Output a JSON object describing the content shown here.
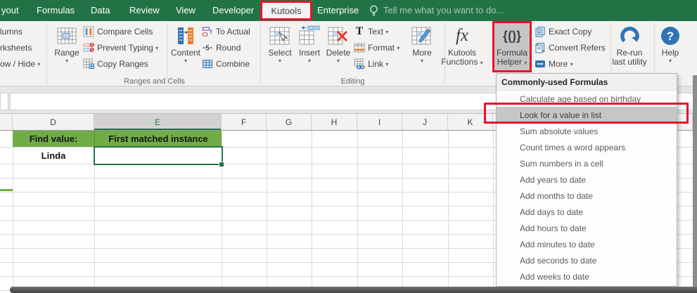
{
  "colors": {
    "titlebar_green": "#217346",
    "annotation_red": "#e8112d",
    "cell_fill_green": "#70ad47",
    "selection_green": "#217346",
    "menu_highlight": "#c6c6c6"
  },
  "tab_bar": {
    "tabs": [
      {
        "label": "yout"
      },
      {
        "label": "Formulas"
      },
      {
        "label": "Data"
      },
      {
        "label": "Review"
      },
      {
        "label": "View"
      },
      {
        "label": "Developer"
      },
      {
        "label": "Kutools",
        "active": true
      },
      {
        "label": "Enterprise"
      }
    ],
    "tell_me": {
      "icon": "lightbulb-icon",
      "label": "Tell me what you want to do..."
    }
  },
  "ribbon": {
    "clipped_group": {
      "items": [
        {
          "label": "lumns"
        },
        {
          "label": "rksheets"
        },
        {
          "label": "ow / Hide",
          "has_dropdown": true
        }
      ]
    },
    "big_buttons": [
      {
        "id": "range",
        "label": "Range",
        "has_dropdown": true
      },
      {
        "id": "content",
        "label": "Content",
        "has_dropdown": true
      },
      {
        "id": "select",
        "label": "Select",
        "has_dropdown": true
      },
      {
        "id": "insert",
        "label": "Insert",
        "has_dropdown": true
      },
      {
        "id": "delete",
        "label": "Delete",
        "has_dropdown": true
      },
      {
        "id": "more_editing",
        "label": "More",
        "has_dropdown": true
      },
      {
        "id": "kutools_functions",
        "label1": "Kutools",
        "label2": "Functions",
        "has_dropdown": true
      },
      {
        "id": "formula_helper",
        "label1": "Formula",
        "label2": "Helper",
        "has_dropdown": true,
        "pressed": true
      },
      {
        "id": "rerun_last_utility",
        "label1": "Re-run",
        "label2": "last utility"
      },
      {
        "id": "help",
        "label": "Help",
        "has_dropdown": true
      }
    ],
    "small_buttons": [
      {
        "id": "compare_cells",
        "label": "Compare Cells"
      },
      {
        "id": "prevent_typing",
        "label": "Prevent Typing",
        "has_dropdown": true
      },
      {
        "id": "copy_ranges",
        "label": "Copy Ranges"
      },
      {
        "id": "to_actual",
        "label": "To Actual"
      },
      {
        "id": "round",
        "label": "Round"
      },
      {
        "id": "combine",
        "label": "Combine"
      },
      {
        "id": "text",
        "label": "Text",
        "has_dropdown": true
      },
      {
        "id": "format",
        "label": "Format",
        "has_dropdown": true
      },
      {
        "id": "link",
        "label": "Link",
        "has_dropdown": true
      },
      {
        "id": "exact_copy",
        "label": "Exact Copy"
      },
      {
        "id": "convert_refers",
        "label": "Convert Refers"
      },
      {
        "id": "more",
        "label": "More",
        "has_dropdown": true
      }
    ],
    "group_labels": [
      {
        "label": "Ranges and Cells"
      },
      {
        "label": "Editing"
      }
    ]
  },
  "formula_bar": {
    "value": ""
  },
  "sheet": {
    "column_headers": [
      {
        "label": "D"
      },
      {
        "label": "E",
        "selected": true
      },
      {
        "label": "F"
      },
      {
        "label": "G"
      },
      {
        "label": "H"
      },
      {
        "label": "I"
      },
      {
        "label": "J"
      },
      {
        "label": "K"
      }
    ],
    "cells": {
      "d1": "Find value:",
      "e1": "First matched instance",
      "d2": "Linda",
      "e2": ""
    }
  },
  "dropdown_menu": {
    "header": "Commonly-used Formulas",
    "items": [
      {
        "label": "Calculate age based on birthday"
      },
      {
        "label": "Look for a value in list",
        "highlighted": true
      },
      {
        "label": "Sum absolute values"
      },
      {
        "label": "Count times a word appears"
      },
      {
        "label": "Sum numbers in a cell"
      },
      {
        "label": "Add years to date"
      },
      {
        "label": "Add months to date"
      },
      {
        "label": "Add days to date"
      },
      {
        "label": "Add hours to date"
      },
      {
        "label": "Add minutes to date"
      },
      {
        "label": "Add seconds to date"
      },
      {
        "label": "Add weeks to date"
      }
    ]
  }
}
